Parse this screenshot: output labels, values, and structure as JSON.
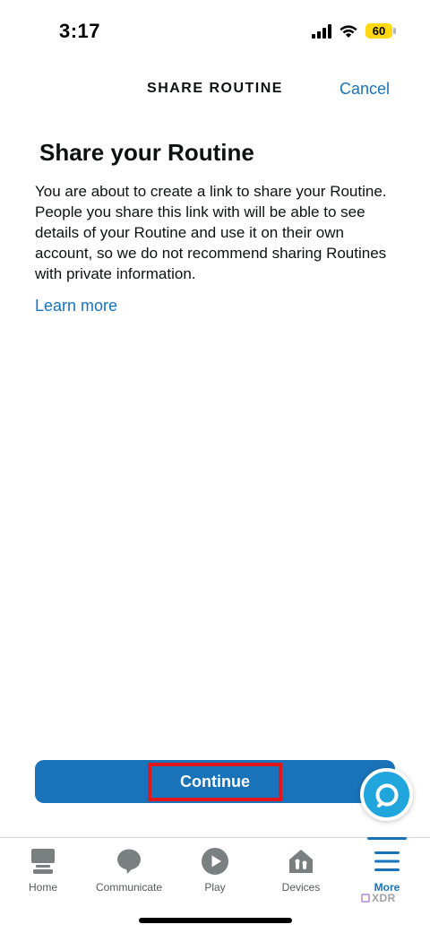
{
  "status_bar": {
    "time": "3:17",
    "battery": "60"
  },
  "header": {
    "title": "SHARE ROUTINE",
    "cancel_label": "Cancel"
  },
  "content": {
    "title": "Share your Routine",
    "body": "You are about to create a link to share your Routine. People you share this link with will be able to see details of your Routine and use it on their own account, so we do not recommend sharing Routines with private information.",
    "learn_more_label": "Learn more"
  },
  "continue_label": "Continue",
  "alexa_icon": "alexa-ring-icon",
  "bottom_nav": {
    "items": [
      {
        "label": "Home",
        "icon": "home-icon"
      },
      {
        "label": "Communicate",
        "icon": "speech-bubble-icon"
      },
      {
        "label": "Play",
        "icon": "play-icon"
      },
      {
        "label": "Devices",
        "icon": "devices-home-icon"
      },
      {
        "label": "More",
        "icon": "menu-icon"
      }
    ],
    "active": "More"
  },
  "watermark": "XDR",
  "colors": {
    "accent": "#1a73b8",
    "alexa": "#20a6dd",
    "highlight_box": "#e0161b",
    "battery": "#ffd814"
  }
}
